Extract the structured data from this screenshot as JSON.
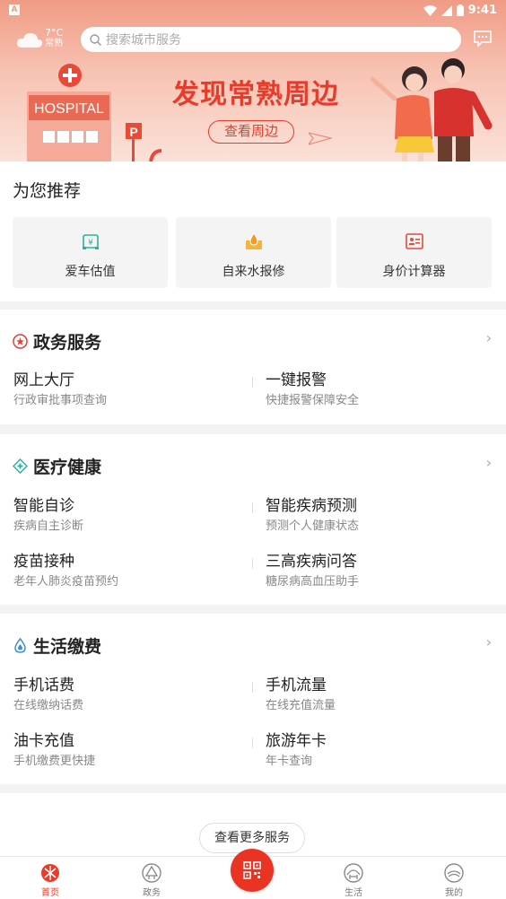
{
  "status": {
    "sim": "A",
    "time": "9:41"
  },
  "weather": {
    "temp": "7°C",
    "city": "常熟"
  },
  "search": {
    "placeholder": "搜索城市服务"
  },
  "banner": {
    "hospital_sign": "HOSPITAL",
    "parking_sign": "P",
    "title": "发现常熟周边",
    "button": "查看周边"
  },
  "recommend": {
    "title": "为您推荐",
    "items": [
      {
        "label": "爱车估值",
        "icon": "car-icon"
      },
      {
        "label": "自来水报修",
        "icon": "water-repair-icon"
      },
      {
        "label": "身价计算器",
        "icon": "id-card-icon"
      }
    ]
  },
  "sections": [
    {
      "title": "政务服务",
      "icon": "government-icon",
      "items": [
        {
          "title": "网上大厅",
          "sub": "行政审批事项查询"
        },
        {
          "title": "一键报警",
          "sub": "快捷报警保障安全"
        }
      ]
    },
    {
      "title": "医疗健康",
      "icon": "medical-icon",
      "items": [
        {
          "title": "智能自诊",
          "sub": "疾病自主诊断"
        },
        {
          "title": "智能疾病预测",
          "sub": "预测个人健康状态"
        },
        {
          "title": "疫苗接种",
          "sub": "老年人肺炎疫苗预约"
        },
        {
          "title": "三高疾病问答",
          "sub": "糖尿病高血压助手"
        }
      ]
    },
    {
      "title": "生活缴费",
      "icon": "water-drop-icon",
      "items": [
        {
          "title": "手机话费",
          "sub": "在线缴纳话费"
        },
        {
          "title": "手机流量",
          "sub": "在线充值流量"
        },
        {
          "title": "油卡充值",
          "sub": "手机缴费更快捷"
        },
        {
          "title": "旅游年卡",
          "sub": "年卡查询"
        }
      ]
    }
  ],
  "more_button": "查看更多服务",
  "tabs": [
    {
      "label": "首页",
      "icon": "home-icon",
      "active": true
    },
    {
      "label": "政务",
      "icon": "government-tab-icon",
      "active": false
    },
    {
      "label": "生活",
      "icon": "life-tab-icon",
      "active": false
    },
    {
      "label": "我的",
      "icon": "profile-tab-icon",
      "active": false
    }
  ],
  "colors": {
    "accent": "#e73c2c",
    "banner_top": "#f09b84",
    "muted_text": "#888888"
  }
}
